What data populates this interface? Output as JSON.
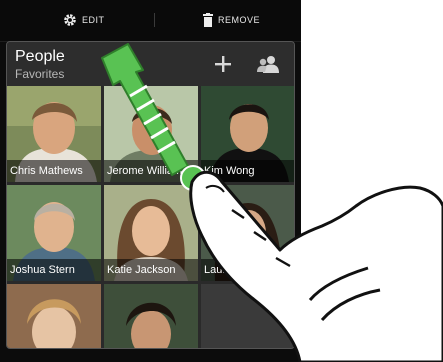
{
  "topbar": {
    "edit_label": "EDIT",
    "remove_label": "REMOVE",
    "edit_icon": "gear-icon",
    "remove_icon": "trash-icon"
  },
  "widget": {
    "title": "People",
    "subtitle": "Favorites",
    "actions": [
      "plus-icon",
      "people-icon"
    ]
  },
  "contacts": [
    {
      "name": "Chris Mathews"
    },
    {
      "name": "Jerome Williams"
    },
    {
      "name": "Kim Wong"
    },
    {
      "name": "Joshua Stern"
    },
    {
      "name": "Katie Jackson"
    },
    {
      "name": "Laura Lee"
    }
  ],
  "colors": {
    "arrow": "#59c253",
    "arrow_dark": "#2f7f2b",
    "background": "#0c0c0c",
    "widget": "#2a2a2a"
  }
}
